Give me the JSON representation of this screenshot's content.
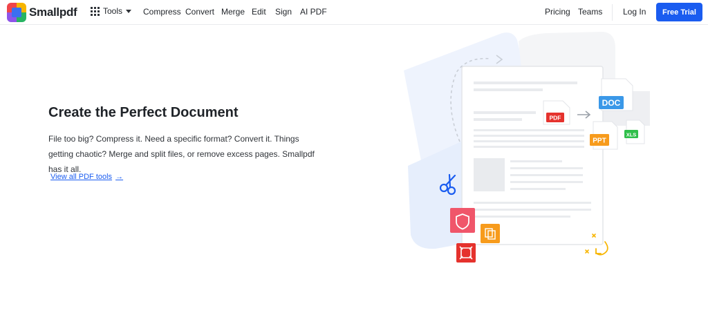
{
  "brand": {
    "name": "Smallpdf",
    "logo_colors": [
      "#f0454a",
      "#f7b500",
      "#28b463",
      "#3b6ff0",
      "#8e54e9",
      "#1ac0c6"
    ]
  },
  "nav": {
    "tools_label": "Tools",
    "links": [
      "Compress",
      "Convert",
      "Merge",
      "Edit",
      "Sign",
      "AI PDF"
    ],
    "right": {
      "pricing": "Pricing",
      "teams": "Teams",
      "login": "Log In",
      "trial": "Free Trial"
    }
  },
  "hero": {
    "title": "Create the Perfect Document",
    "description": "File too big? Compress it. Need a specific format? Convert it. Things getting chaotic? Merge and split files, or remove excess pages. Smallpdf has it all.",
    "link_label": "View all PDF tools",
    "link_arrow": "→"
  },
  "illustration": {
    "badges": {
      "pdf": "PDF",
      "doc": "DOC",
      "ppt": "PPT",
      "xls": "XLS"
    },
    "colors": {
      "primary": "#1a5cf0",
      "pdf_red": "#e5322d",
      "doc_blue": "#3a98e8",
      "ppt_orange": "#f79b1c",
      "xls_green": "#2fbf4a",
      "pink": "#f0566a"
    },
    "icons": [
      "scissors-icon",
      "shield-icon",
      "compress-icon",
      "crop-icon",
      "arrow-right-icon",
      "rotate-icon",
      "sparkle-icon"
    ]
  }
}
